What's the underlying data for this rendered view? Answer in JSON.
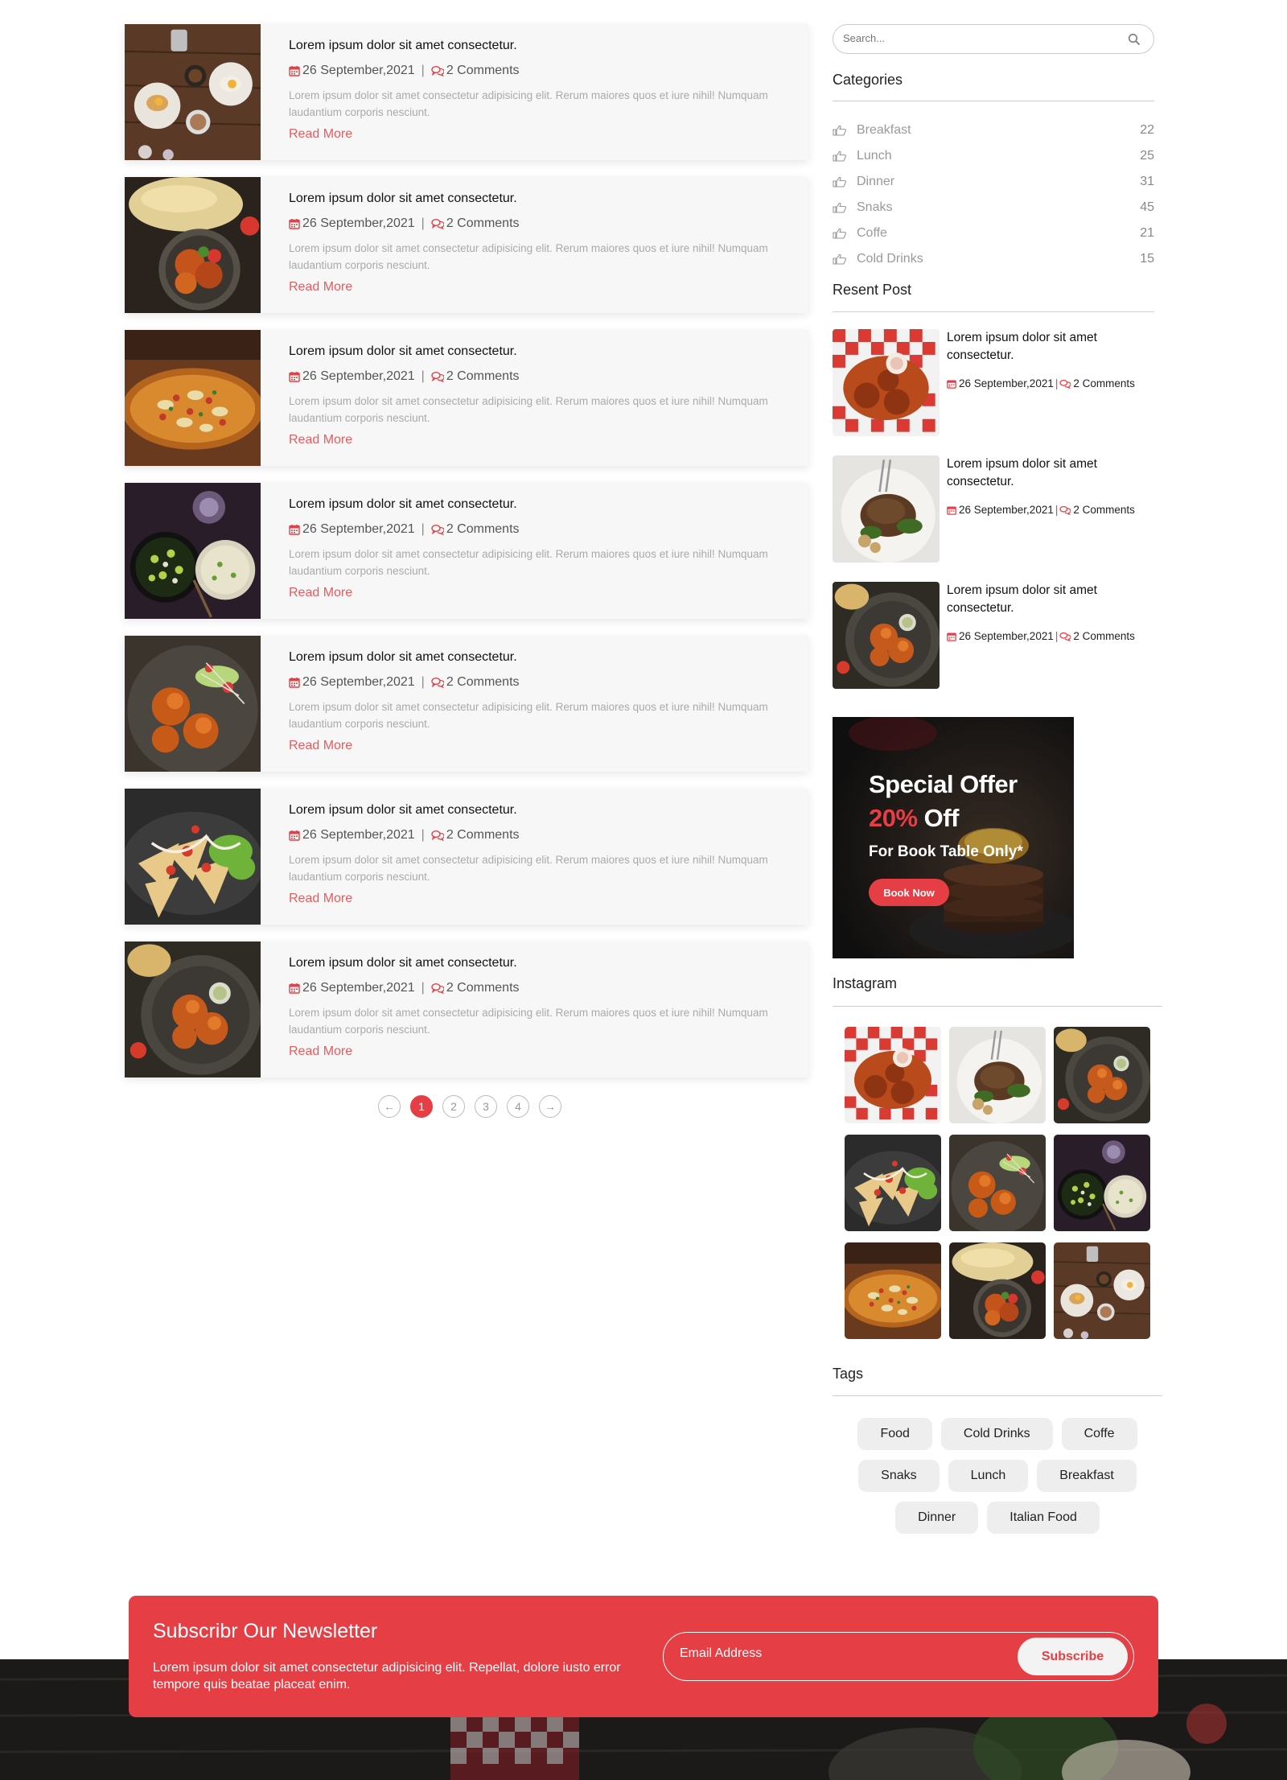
{
  "colors": {
    "accent": "#e63e45",
    "readmore": "#e75b5f",
    "card_bg": "#f7f7f7",
    "tag_bg": "#eeeeee"
  },
  "posts": [
    {
      "title": "Lorem ipsum dolor sit amet consectetur.",
      "date": "26 September,2021",
      "comments": "2 Comments",
      "excerpt": "Lorem ipsum dolor sit amet consectetur adipisicing elit. Rerum maiores quos et iure nihil! Numquam laudantium corporis nesciunt.",
      "read_more": "Read More",
      "image": "breakfast-table"
    },
    {
      "title": "Lorem ipsum dolor sit amet consectetur.",
      "date": "26 September,2021",
      "comments": "2 Comments",
      "excerpt": "Lorem ipsum dolor sit amet consectetur adipisicing elit. Rerum maiores quos et iure nihil! Numquam laudantium corporis nesciunt.",
      "read_more": "Read More",
      "image": "fried-chicken-naan"
    },
    {
      "title": "Lorem ipsum dolor sit amet consectetur.",
      "date": "26 September,2021",
      "comments": "2 Comments",
      "excerpt": "Lorem ipsum dolor sit amet consectetur adipisicing elit. Rerum maiores quos et iure nihil! Numquam laudantium corporis nesciunt.",
      "read_more": "Read More",
      "image": "pizza"
    },
    {
      "title": "Lorem ipsum dolor sit amet consectetur.",
      "date": "26 September,2021",
      "comments": "2 Comments",
      "excerpt": "Lorem ipsum dolor sit amet consectetur adipisicing elit. Rerum maiores quos et iure nihil! Numquam laudantium corporis nesciunt.",
      "read_more": "Read More",
      "image": "salad-bowls"
    },
    {
      "title": "Lorem ipsum dolor sit amet consectetur.",
      "date": "26 September,2021",
      "comments": "2 Comments",
      "excerpt": "Lorem ipsum dolor sit amet consectetur adipisicing elit. Rerum maiores quos et iure nihil! Numquam laudantium corporis nesciunt.",
      "read_more": "Read More",
      "image": "fried-chicken-salad"
    },
    {
      "title": "Lorem ipsum dolor sit amet consectetur.",
      "date": "26 September,2021",
      "comments": "2 Comments",
      "excerpt": "Lorem ipsum dolor sit amet consectetur adipisicing elit. Rerum maiores quos et iure nihil! Numquam laudantium corporis nesciunt.",
      "read_more": "Read More",
      "image": "nachos"
    },
    {
      "title": "Lorem ipsum dolor sit amet consectetur.",
      "date": "26 September,2021",
      "comments": "2 Comments",
      "excerpt": "Lorem ipsum dolor sit amet consectetur adipisicing elit. Rerum maiores quos et iure nihil! Numquam laudantium corporis nesciunt.",
      "read_more": "Read More",
      "image": "fried-chicken-plate"
    }
  ],
  "pagination": {
    "prev": "←",
    "pages": [
      "1",
      "2",
      "3",
      "4"
    ],
    "active": "1",
    "next": "→"
  },
  "sidebar": {
    "search_placeholder": "Search...",
    "categories_title": "Categories",
    "categories": [
      {
        "label": "Breakfast",
        "count": "22"
      },
      {
        "label": "Lunch",
        "count": "25"
      },
      {
        "label": "Dinner",
        "count": "31"
      },
      {
        "label": "Snaks",
        "count": "45"
      },
      {
        "label": "Coffe",
        "count": "21"
      },
      {
        "label": "Cold Drinks",
        "count": "15"
      }
    ],
    "recent_title": "Resent Post",
    "recent": [
      {
        "title": "Lorem ipsum dolor sit amet consectetur.",
        "date": "26 September,2021",
        "comments": "2 Comments",
        "image": "chicken-basket"
      },
      {
        "title": "Lorem ipsum dolor sit amet consectetur.",
        "date": "26 September,2021",
        "comments": "2 Comments",
        "image": "steak-plate"
      },
      {
        "title": "Lorem ipsum dolor sit amet consectetur.",
        "date": "26 September,2021",
        "comments": "2 Comments",
        "image": "fried-chicken-plate"
      }
    ],
    "offer": {
      "line1": "Special Offer",
      "percent": "20%",
      "off": "Off",
      "line3": "For Book Table Only*",
      "button": "Book Now"
    },
    "instagram_title": "Instagram",
    "instagram": [
      "chicken-basket",
      "steak-plate",
      "fried-chicken-plate",
      "nachos",
      "fried-chicken-salad",
      "salad-bowls",
      "pizza",
      "fried-chicken-naan",
      "breakfast-table"
    ],
    "tags_title": "Tags",
    "tags": [
      [
        "Food",
        "Cold Drinks",
        "Coffe"
      ],
      [
        "Snaks",
        "Lunch",
        "Breakfast"
      ],
      [
        "Dinner",
        "Italian Food"
      ]
    ]
  },
  "newsletter": {
    "title": "Subscribr Our Newsletter",
    "text": "Lorem ipsum dolor sit amet consectetur adipisicing elit. Repellat, dolore iusto error tempore quis beatae placeat enim.",
    "placeholder": "Email Address",
    "button": "Subscribe"
  }
}
